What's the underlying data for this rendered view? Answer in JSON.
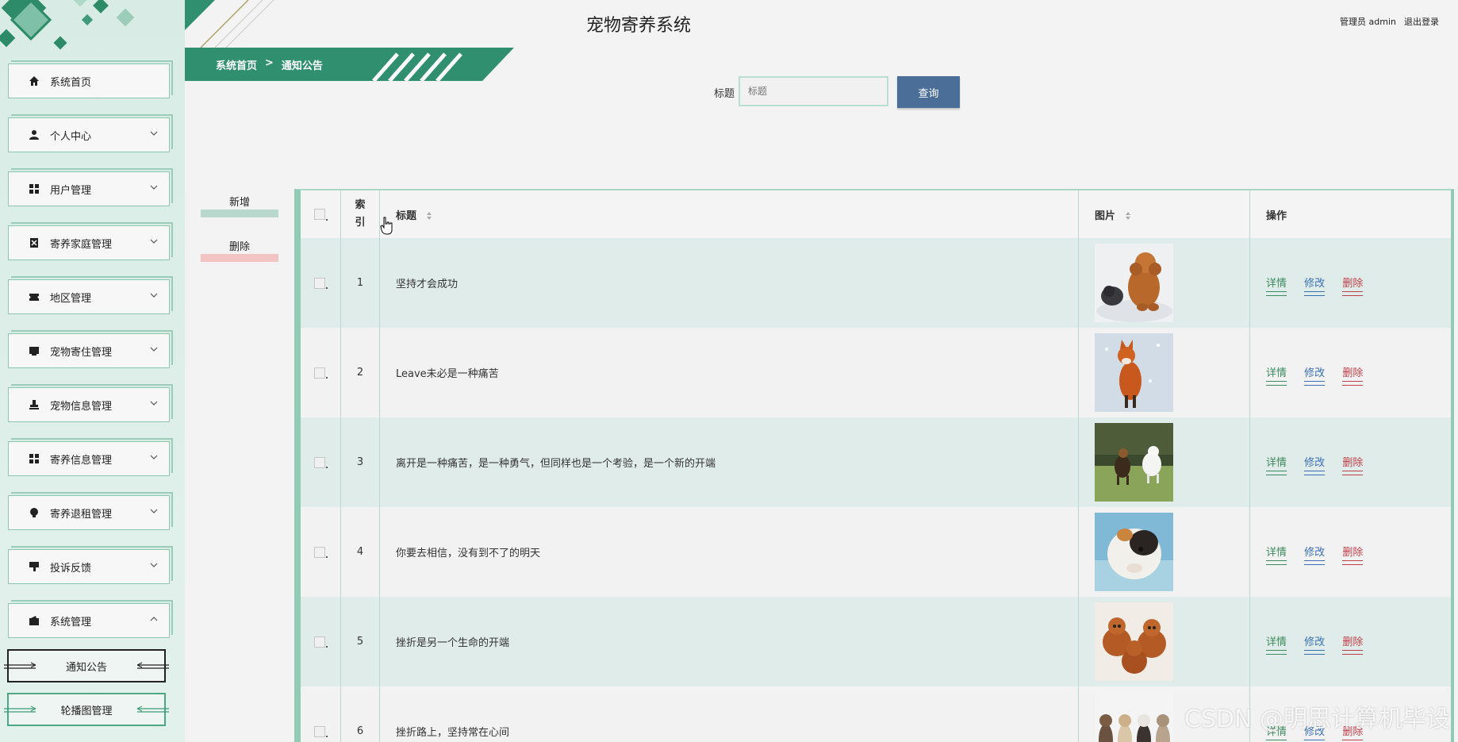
{
  "header": {
    "title": "宠物寄养系统",
    "user_label": "管理员 admin",
    "logout_label": "退出登录"
  },
  "breadcrumb": {
    "home": "系统首页",
    "separator": ">",
    "current": "通知公告"
  },
  "sidebar": {
    "items": [
      {
        "label": "系统首页",
        "icon": "home-icon"
      },
      {
        "label": "个人中心",
        "icon": "user-icon"
      },
      {
        "label": "用户管理",
        "icon": "grid-icon"
      },
      {
        "label": "寄养家庭管理",
        "icon": "document-icon"
      },
      {
        "label": "地区管理",
        "icon": "ticket-icon"
      },
      {
        "label": "宠物寄住管理",
        "icon": "inbox-icon"
      },
      {
        "label": "宠物信息管理",
        "icon": "stamp-icon"
      },
      {
        "label": "寄养信息管理",
        "icon": "grid-icon"
      },
      {
        "label": "寄养退租管理",
        "icon": "bulb-icon"
      },
      {
        "label": "投诉反馈",
        "icon": "sign-icon"
      },
      {
        "label": "系统管理",
        "icon": "wallet-icon"
      }
    ],
    "sub_items": [
      {
        "label": "通知公告",
        "active": true
      },
      {
        "label": "轮播图管理",
        "active": false
      }
    ]
  },
  "search": {
    "label": "标题",
    "placeholder": "标题",
    "button": "查询"
  },
  "actions": {
    "add": "新增",
    "delete": "删除"
  },
  "table": {
    "headers": {
      "index": "索引",
      "title": "标题",
      "image": "图片",
      "ops": "操作"
    },
    "op_labels": {
      "detail": "详情",
      "edit": "修改",
      "delete": "删除"
    },
    "rows": [
      {
        "index": "1",
        "title": "坚持才会成功",
        "image": "poodle-and-kitten"
      },
      {
        "index": "2",
        "title": "Leave未必是一种痛苦",
        "image": "fox-in-snow"
      },
      {
        "index": "3",
        "title": "离开是一种痛苦，是一种勇气，但同样也是一个考验，是一个新的开端",
        "image": "dogs-running"
      },
      {
        "index": "4",
        "title": "你要去相信，没有到不了的明天",
        "image": "guinea-pig"
      },
      {
        "index": "5",
        "title": "挫折是另一个生命的开端",
        "image": "poodle-puppies"
      },
      {
        "index": "6",
        "title": "挫折路上，坚持常在心间",
        "image": "dog-group"
      }
    ]
  },
  "watermark": "CSDN @明思计算机毕设",
  "colors": {
    "accent": "#2f8f6f",
    "button_blue": "#4b6e99",
    "detail": "#3d8a5f",
    "edit": "#3a6fb5",
    "delete": "#c0404a"
  }
}
